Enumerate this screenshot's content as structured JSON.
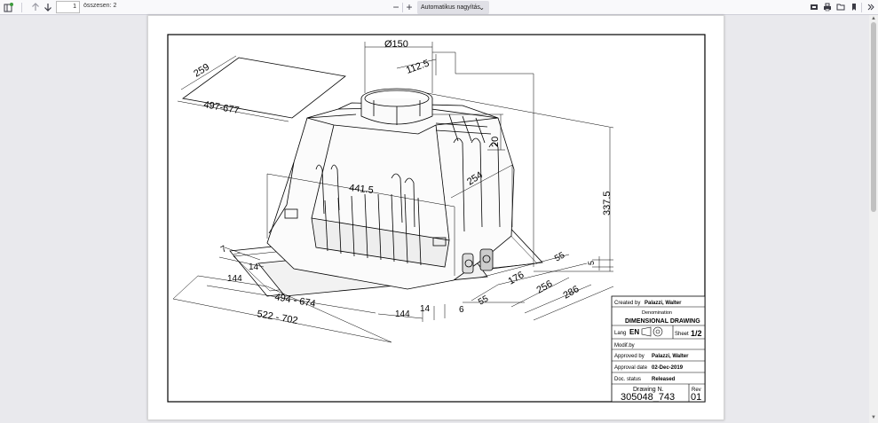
{
  "toolbar": {
    "page_number": "1",
    "page_total": "összesen: 2",
    "zoom_label": "Automatikus nagyítás",
    "zoom_out": "−",
    "zoom_in": "+"
  },
  "drawing": {
    "dims": {
      "d150": "Ø150",
      "d112_5": "112.5",
      "d20": "20",
      "d337_5": "337.5",
      "d5": "5",
      "d259": "259",
      "d497_677": "497-677",
      "d441_5": "441.5",
      "d254": "254",
      "d7": "7",
      "d14a": "14",
      "d144a": "144",
      "d494_674": "494  -  674",
      "d522_702": "522  -  702",
      "d144b": "144",
      "d14b": "14",
      "d6": "6",
      "d55a": "55",
      "d55b": "55",
      "d176": "176",
      "d256": "256",
      "d286": "286"
    },
    "title_block": {
      "created_label": "Created by",
      "created_value": "Palazzi, Walter",
      "denomination_label": "Denomination",
      "denomination_value": "DIMENSIONAL  DRAWING",
      "lang_label": "Lang",
      "lang_value": "EN",
      "sheet_label": "Sheet",
      "sheet_value": "1/2",
      "modif_label": "Modif.by",
      "approved_label": "Approved by",
      "approved_value": "Palazzi, Walter",
      "approval_date_label": "Approval date",
      "approval_date_value": "02-Dec-2019",
      "doc_status_label": "Doc. status",
      "doc_status_value": "Released",
      "drawing_n_label": "Drawing N.",
      "drawing_n_value": "305048_743",
      "rev_label": "Rev",
      "rev_value": "01"
    }
  }
}
